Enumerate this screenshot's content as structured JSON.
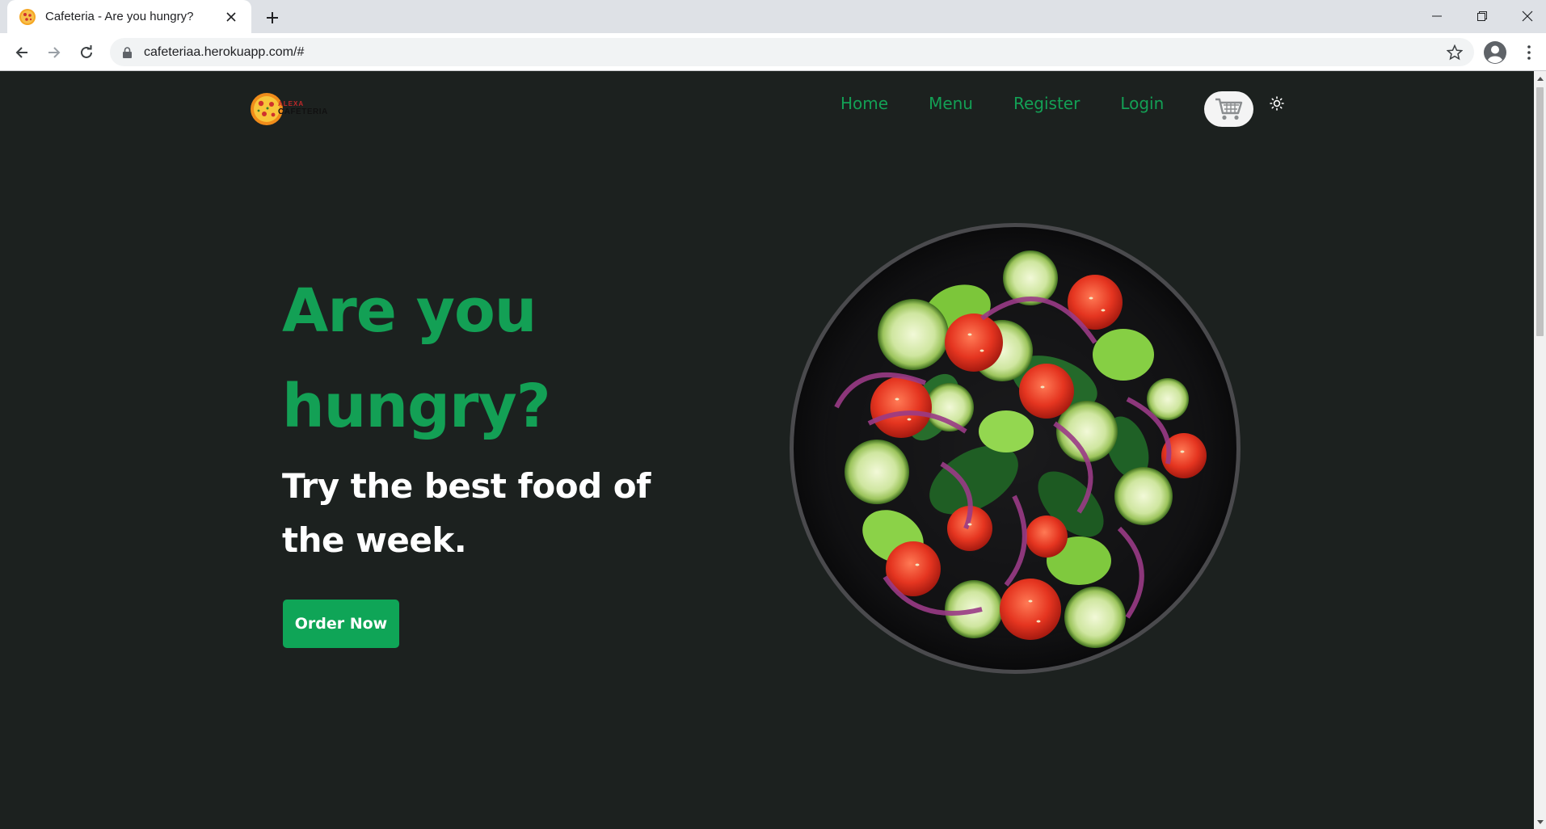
{
  "browser": {
    "tab_title": "Cafeteria - Are you hungry?",
    "url": "cafeteriaa.herokuapp.com/#",
    "icons": [
      "pizza-favicon",
      "close-icon",
      "plus-icon",
      "minimize-icon",
      "restore-icon",
      "close-window-icon",
      "back-icon",
      "forward-icon",
      "reload-icon",
      "lock-icon",
      "star-icon",
      "profile-icon",
      "menu-icon"
    ]
  },
  "site": {
    "logo": {
      "line1": "ALEXA",
      "line2": "CAFETERIA"
    },
    "nav": [
      {
        "label": "Home"
      },
      {
        "label": "Menu"
      },
      {
        "label": "Register"
      },
      {
        "label": "Login"
      }
    ],
    "hero": {
      "title": "Are you hungry?",
      "subtitle": "Try the best food of the week.",
      "cta": "Order Now"
    },
    "colors": {
      "background": "#1c211f",
      "accent": "#13a055",
      "button": "#0fa557",
      "text": "#ffffff"
    }
  }
}
